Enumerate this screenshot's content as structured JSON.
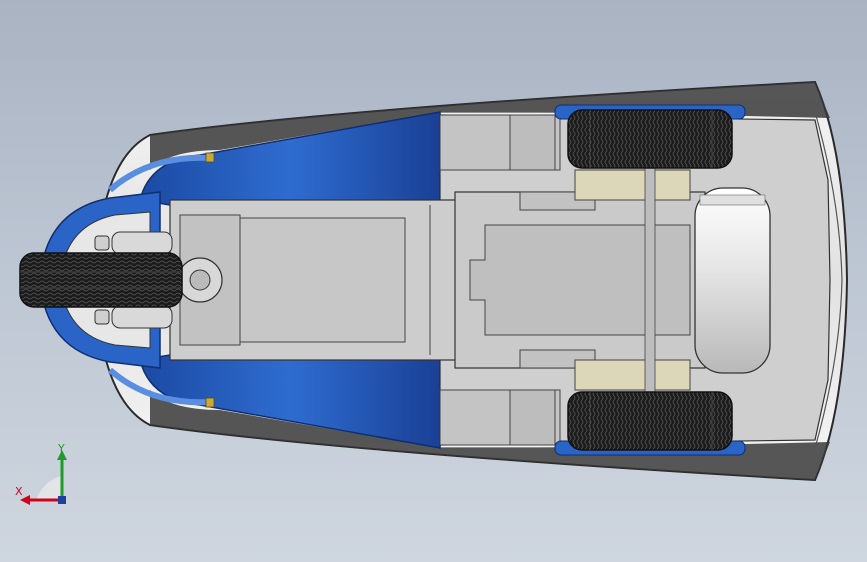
{
  "view": {
    "background_top": "#a9b3c2",
    "background_bottom": "#cfd6df"
  },
  "model": {
    "body_color": "#2c5fb8",
    "body_dark": "#1a3f8a",
    "chassis_color": "#c9c9c9",
    "tire_color": "#1e1e1e"
  },
  "triad": {
    "x_label": "X",
    "y_label": "Y",
    "x_color": "#d0021b",
    "y_color": "#1f9a2b",
    "z_color": "#1f3fa0"
  }
}
